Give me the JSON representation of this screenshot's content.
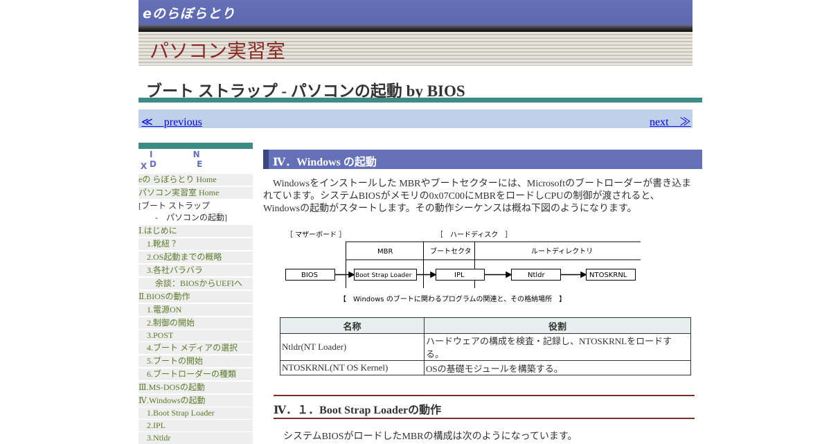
{
  "header": {
    "logo": "eのらぼらとり",
    "section": "パソコン実習室",
    "page_title": "ブート ストラップ - パソコンの起動 by BIOS"
  },
  "nav": {
    "previous": "≪　previous",
    "next": "next　≫"
  },
  "sidebar": {
    "index_line1": "I N D E",
    "index_line2": "X",
    "items": [
      "eの らぼらとり Home",
      "パソコン実習室 Home",
      "[ブート ストラップ",
      "　　-　パソコンの起動]",
      "Ⅰ.はじめに",
      "　1.靴紐 ？",
      "　2.OS起動までの概略",
      "　3.各社バラバラ",
      "　　余談：BIOSからUEFIへ",
      "Ⅱ.BIOSの動作",
      "　1.電源ON",
      "　2.制御の開始",
      "　3.POST",
      "　4.ブート メディアの選択",
      "　5.ブートの開始",
      "　6.ブートローダーの種類",
      "Ⅲ.MS-DOSの起動",
      "Ⅳ.Windowsの起動",
      "　1.Boot Strap Loader",
      "　2.IPL",
      "　3.Ntldr"
    ]
  },
  "main": {
    "section_heading": "Ⅳ．Windows の起動",
    "intro": "Windowsをインストールした MBRやブートセクターには、Microsoftのブートローダーが書き込まれています。システムBIOSがメモリの0x07C00にMBRをロードしCPUの制御が渡されると、Windowsの起動がスタートします。その動作シーケンスは概ね下図のようになります。",
    "diagram": {
      "motherboard_label": "［ マザーボード ］",
      "harddisk_label": "［　ハードディスク　］",
      "col_mbr": "MBR",
      "col_bootsector": "ブートセクタ",
      "col_rootdir": "ルートディレクトリ",
      "box_bios": "BIOS",
      "box_bsl": "Boot Strap Loader",
      "box_ipl": "IPL",
      "box_ntldr": "Ntldr",
      "box_ntoskrnl": "NTOSKRNL",
      "caption": "【　Windows のブートに関わるプログラムの関連と、その格納場所　】"
    },
    "table": {
      "headers": [
        "名称",
        "役割"
      ],
      "rows": [
        [
          "Ntldr(NT Loader)",
          "ハードウェアの構成を検査・記録し、NTOSKRNLをロードする。"
        ],
        [
          "NTOSKRNL(NT OS Kernel)",
          "OSの基礎モジュールを構築する。"
        ]
      ]
    },
    "sub_heading": "Ⅳ．１．Boot Strap Loaderの動作",
    "sub_text": "システムBIOSがロードしたMBRの構成は次のようになっています。"
  }
}
